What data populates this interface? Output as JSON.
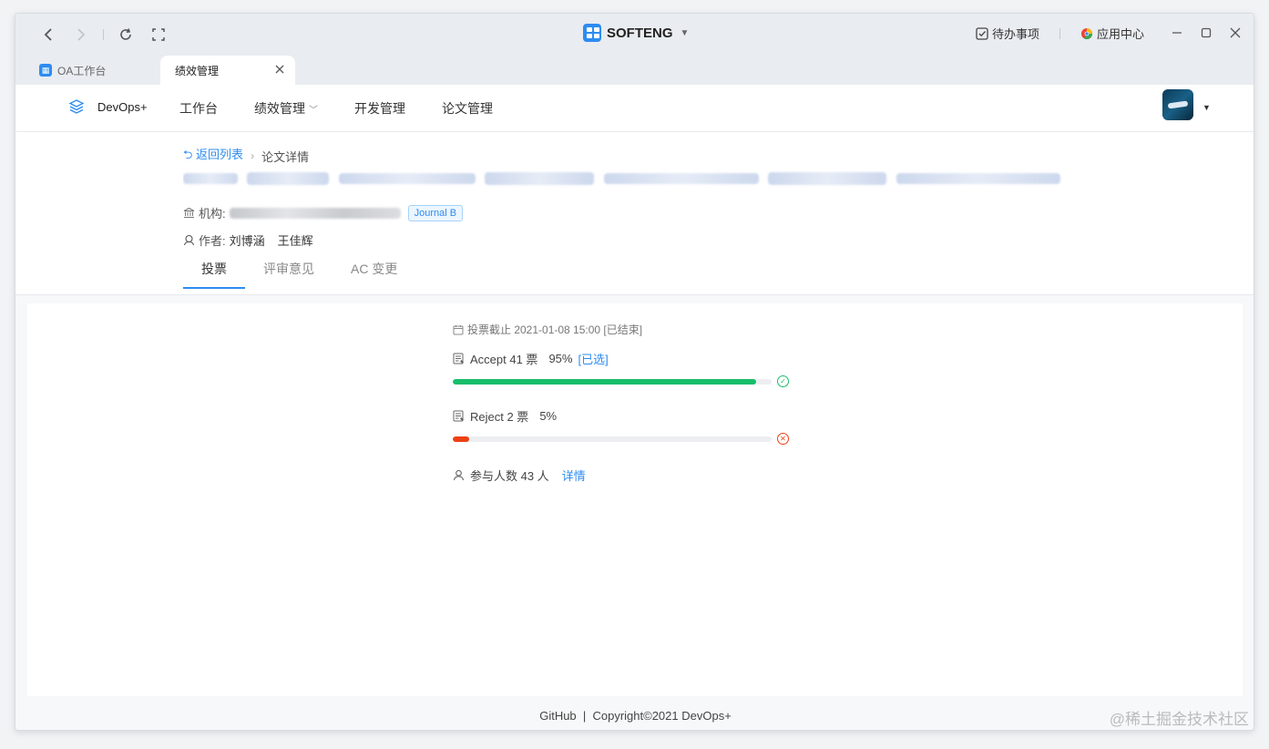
{
  "titlebar": {
    "brand": "SOFTENG",
    "todo_label": "待办事项",
    "app_center_label": "应用中心"
  },
  "tabs": [
    {
      "label": "OA工作台"
    },
    {
      "label": "绩效管理"
    }
  ],
  "appnav": {
    "logo_text": "DevOps+",
    "menu": [
      {
        "label": "工作台"
      },
      {
        "label": "绩效管理"
      },
      {
        "label": "开发管理"
      },
      {
        "label": "论文管理"
      }
    ]
  },
  "paper": {
    "breadcrumb_back": "返回列表",
    "breadcrumb_current": "论文详情",
    "org_label": "机构:",
    "journal_tag": "Journal B",
    "authors_label": "作者:",
    "authors": [
      "刘博涵",
      "王佳辉"
    ],
    "tabs": [
      {
        "label": "投票"
      },
      {
        "label": "评审意见"
      },
      {
        "label": "AC 变更"
      }
    ]
  },
  "vote": {
    "deadline": "投票截止 2021-01-08 15:00 [已结束]",
    "options": [
      {
        "label": "Accept 41 票",
        "percent_text": "95%",
        "selected_text": "[已选]",
        "percent": 95,
        "color": "#19be6b"
      },
      {
        "label": "Reject 2 票",
        "percent_text": "5%",
        "selected_text": "",
        "percent": 5,
        "color": "#ed4014"
      }
    ],
    "participants": "参与人数 43 人",
    "detail_link": "详情"
  },
  "footer": {
    "text": "GitHub  |  Copyright©2021 DevOps+"
  },
  "watermark": "@稀土掘金技术社区"
}
